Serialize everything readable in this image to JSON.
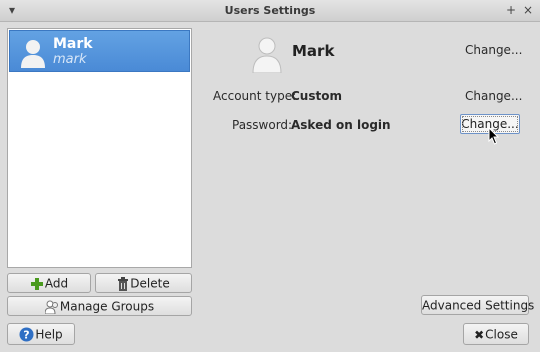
{
  "window": {
    "title": "Users Settings",
    "menu_glyph": "▾",
    "pin_glyph": "+",
    "close_glyph": "×"
  },
  "users": [
    {
      "name": "Mark",
      "login": "mark",
      "selected": true
    }
  ],
  "detail": {
    "name": "Mark",
    "change_name_label": "Change...",
    "account_type_label": "Account type:",
    "account_type_value": "Custom",
    "account_change_label": "Change...",
    "password_label": "Password:",
    "password_value": "Asked on login",
    "password_change_label": "Change..."
  },
  "buttons": {
    "add": "Add",
    "delete": "Delete",
    "manage_groups": "Manage Groups",
    "advanced_settings": "Advanced Settings",
    "help": "Help",
    "close": "Close"
  },
  "colors": {
    "selection": "#4a8ad6",
    "add_icon": "#4a9a1e",
    "help_icon": "#2f6fc4"
  },
  "icons": {
    "add": "plus-icon",
    "delete": "trash-icon",
    "manage_groups": "groups-icon",
    "help": "help-icon",
    "close": "close-icon",
    "avatar": "user-avatar-icon"
  }
}
